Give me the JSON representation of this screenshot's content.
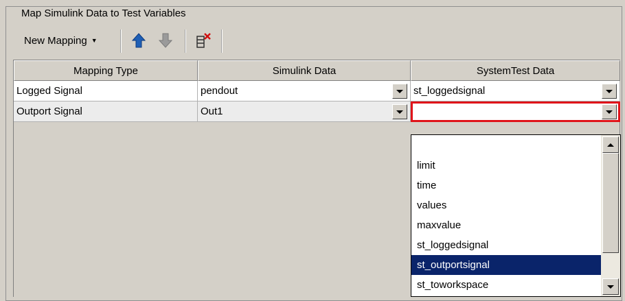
{
  "panel": {
    "title": "Map Simulink Data to Test Variables"
  },
  "toolbar": {
    "new_mapping_label": "New Mapping",
    "icons": [
      "move-up-arrow-icon",
      "move-down-arrow-icon",
      "delete-mapping-icon"
    ],
    "up_color": "#1f5fb5",
    "down_color": "#9a9a9a",
    "delete_color": "#d01010"
  },
  "table": {
    "columns": [
      "Mapping Type",
      "Simulink Data",
      "SystemTest Data"
    ],
    "rows": [
      {
        "mapping_type": "Logged Signal",
        "simulink_data": "pendout",
        "systemtest_data": "st_loggedsignal"
      },
      {
        "mapping_type": "Outport Signal",
        "simulink_data": "Out1",
        "systemtest_data": ""
      }
    ]
  },
  "dropdown": {
    "options": [
      "",
      "limit",
      "time",
      "values",
      "maxvalue",
      "st_loggedsignal",
      "st_outportsignal",
      "st_toworkspace"
    ],
    "selected": "st_outportsignal",
    "highlight_color": "#0a246a",
    "active_border_color": "#e0141a"
  }
}
